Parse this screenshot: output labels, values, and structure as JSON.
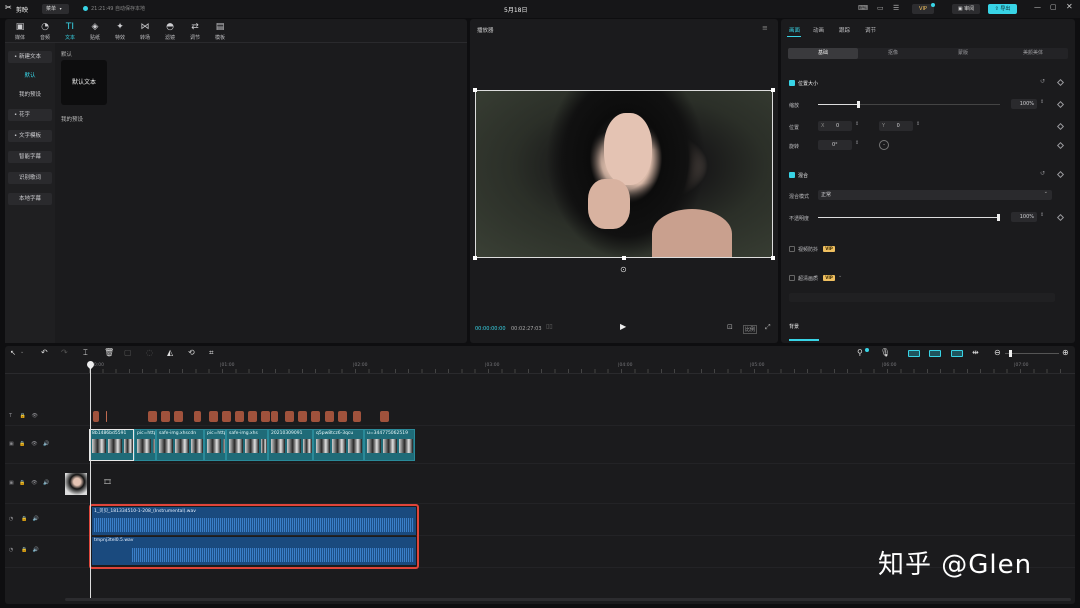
{
  "topbar": {
    "app_name": "剪映",
    "menu_label": "菜单",
    "autosave_text": "21:21:49 自动保存本地",
    "project_title": "5月18日",
    "vip_badge": "VIP",
    "review_label": "审阅",
    "export_label": "导出"
  },
  "media": {
    "tools": [
      {
        "icon": "media-icon",
        "label": "媒体"
      },
      {
        "icon": "audio-icon",
        "label": "音频"
      },
      {
        "icon": "text-icon",
        "label": "文本"
      },
      {
        "icon": "sticker-icon",
        "label": "贴纸"
      },
      {
        "icon": "effects-icon",
        "label": "特效"
      },
      {
        "icon": "transition-icon",
        "label": "转场"
      },
      {
        "icon": "filter-icon",
        "label": "滤镜"
      },
      {
        "icon": "adjust-icon",
        "label": "调节"
      },
      {
        "icon": "template-icon",
        "label": "模板"
      }
    ],
    "sidebar": {
      "new_text": "• 新建文本",
      "default": "默认",
      "my_presets": "我的预设",
      "flower_text": "• 花字",
      "text_template": "• 文字模板",
      "smart_caption": "智能字幕",
      "lyrics": "识别歌词",
      "local_caption": "本地字幕"
    },
    "section_default": "默认",
    "default_text_card": "默认文本",
    "section_my_presets": "我的预设"
  },
  "player": {
    "title": "播放器",
    "time_current": "00:00:00:00",
    "time_total": "00:02:27:03",
    "ratio_label": "比例"
  },
  "props": {
    "tabs": [
      "画面",
      "动画",
      "跟踪",
      "调节"
    ],
    "subtabs": [
      "基础",
      "抠像",
      "蒙版",
      "美颜美体"
    ],
    "position_size": "位置大小",
    "scale_label": "缩放",
    "scale_value": "100%",
    "position_label": "位置",
    "pos_x_label": "X",
    "pos_x_value": "0",
    "pos_y_label": "Y",
    "pos_y_value": "0",
    "rotate_label": "旋转",
    "rotate_value": "0°",
    "blend": "混合",
    "blend_mode_label": "混合模式",
    "blend_mode_value": "正常",
    "opacity_label": "不透明度",
    "opacity_value": "100%",
    "stabilize": "视频防抖",
    "vip": "VIP",
    "superres": "超清画质",
    "background": "背景",
    "scale_fraction": 0.22,
    "opacity_fraction": 1.0
  },
  "timeline": {
    "ruler": [
      "00:00",
      "|01:00",
      "|02:00",
      "|03:00",
      "|04:00",
      "|05:00",
      "|06:00",
      "|07:00"
    ],
    "video_clips": [
      {
        "name": "8b1486bd5591"
      },
      {
        "name": "pic=http"
      },
      {
        "name": "safe-img.xhscdn"
      },
      {
        "name": "pic=http"
      },
      {
        "name": "safe-img.xhs"
      },
      {
        "name": "20210309091"
      },
      {
        "name": "q5pw8tcz6-3qcu"
      },
      {
        "name": "u=344775062519"
      }
    ],
    "audio1_name": "1_贝贝_181334510-1-208_(Instrumental).wav",
    "audio2_name": "tmpnj3tel0.5.wav"
  },
  "watermark": "知乎 @Glen",
  "colors": {
    "accent": "#38d4e6",
    "highlight_box": "#e0453a",
    "text_clip": "#a0523c",
    "video_clip": "#1f6b78",
    "audio_clip": "#1a4a7e"
  }
}
